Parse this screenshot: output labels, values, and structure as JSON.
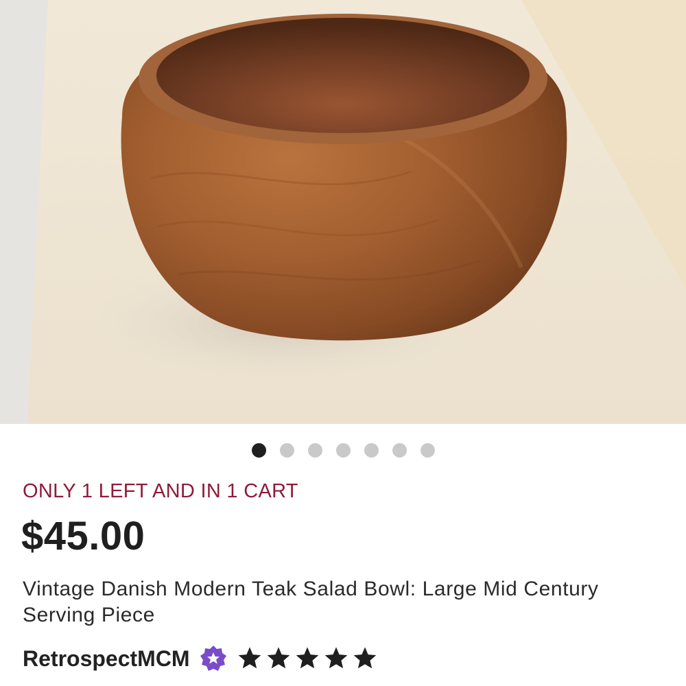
{
  "listing": {
    "image_alt": "Vintage teak salad bowl on light wooden surface",
    "carousel": {
      "total": 7,
      "active_index": 0
    },
    "stock_notice": "ONLY 1 LEFT AND IN 1 CART",
    "price": "$45.00",
    "title": "Vintage Danish Modern Teak Salad Bowl: Large Mid Century Serving Piece",
    "seller": {
      "name": "RetrospectMCM",
      "badge_icon": "star-seller-badge-icon",
      "rating": 5,
      "rating_max": 5
    }
  },
  "colors": {
    "stock_notice": "#8e1b3b",
    "price": "#1f1f1f",
    "badge": "#7b4cc7",
    "dot_active": "#1f1f1f",
    "dot_inactive": "#c9c9c9"
  }
}
